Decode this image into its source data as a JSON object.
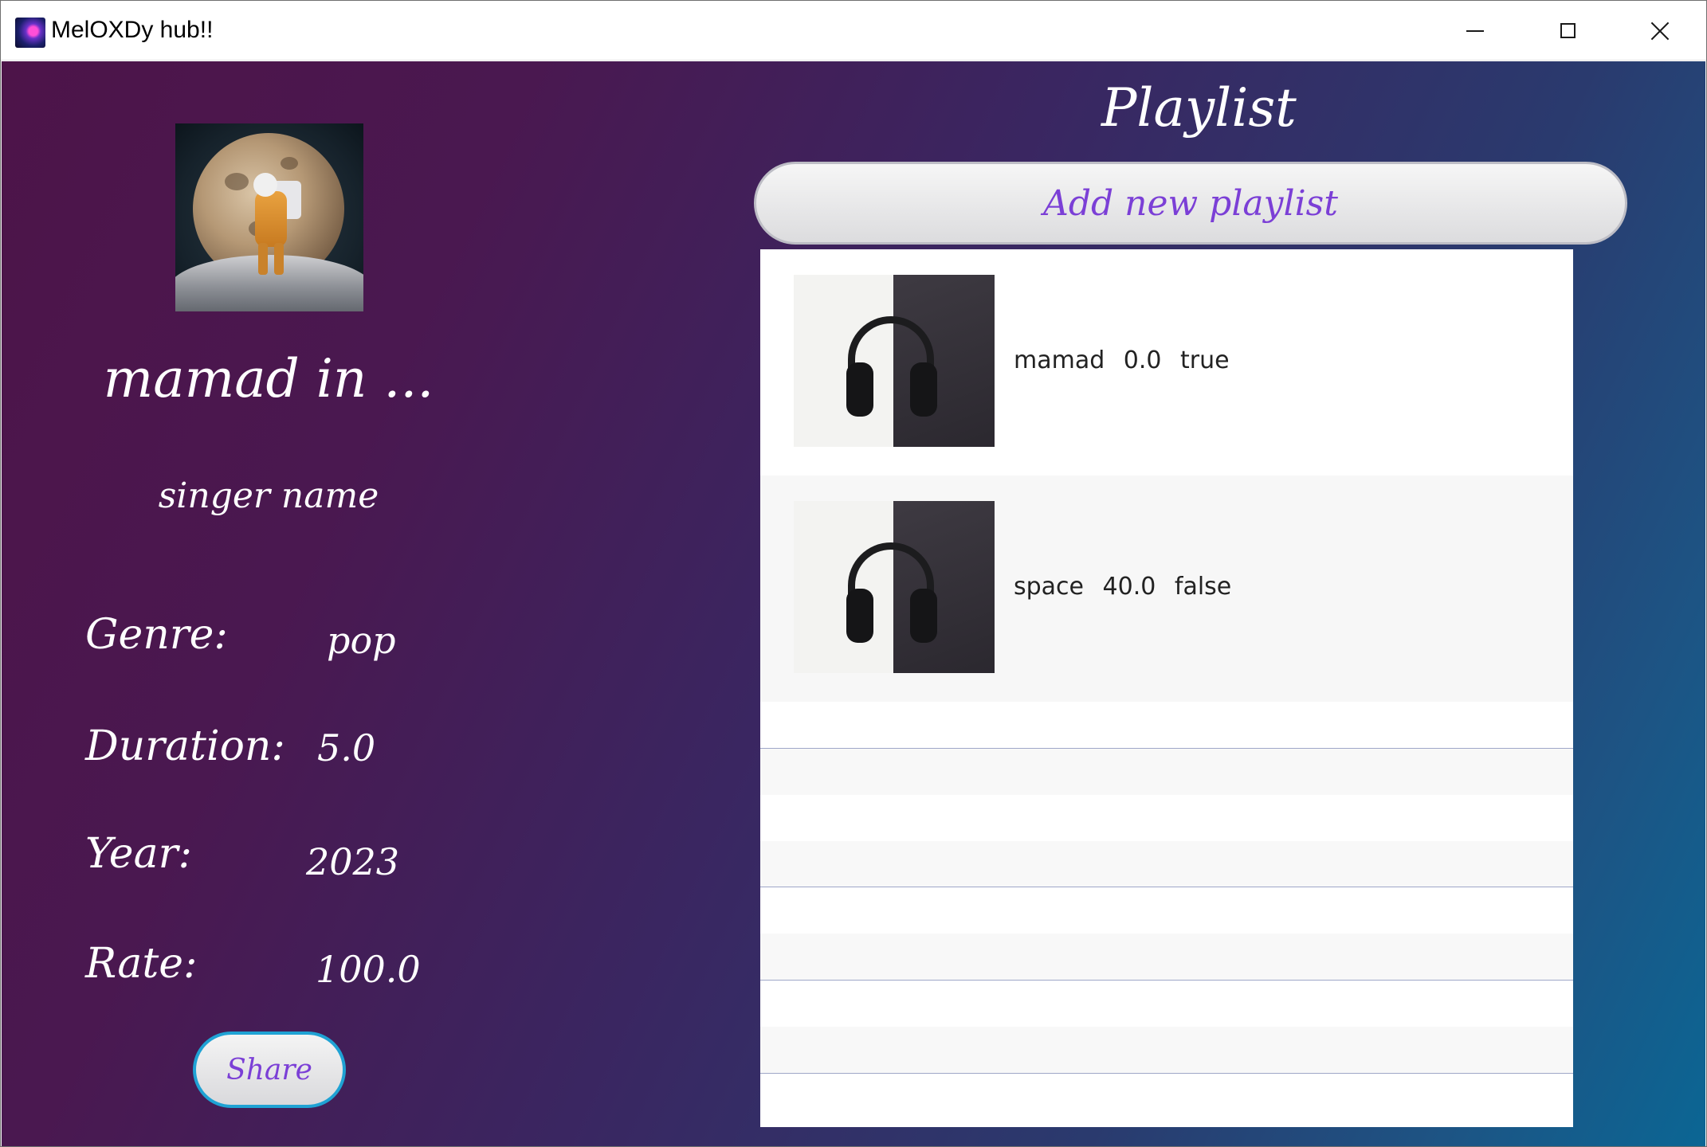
{
  "window": {
    "title": "MelOXDy hub!!",
    "controls": [
      "minimize",
      "maximize",
      "close"
    ]
  },
  "song": {
    "title": "mamad in ...",
    "singer": "singer name",
    "fields": [
      {
        "label": "Genre:",
        "value": "pop"
      },
      {
        "label": "Duration:",
        "value": "5.0"
      },
      {
        "label": "Year:",
        "value": "2023"
      },
      {
        "label": "Rate:",
        "value": "100.0"
      }
    ],
    "share_label": "Share"
  },
  "playlist": {
    "heading": "Playlist",
    "add_label": "Add new playlist",
    "items": [
      {
        "text": "mamad 0.0 true"
      },
      {
        "text": "space 40.0 false"
      }
    ]
  },
  "colors": {
    "accent": "#7b3fd6",
    "share_border": "#1fa2d4",
    "gradient_start": "#4d1449",
    "gradient_end": "#0b6694"
  }
}
